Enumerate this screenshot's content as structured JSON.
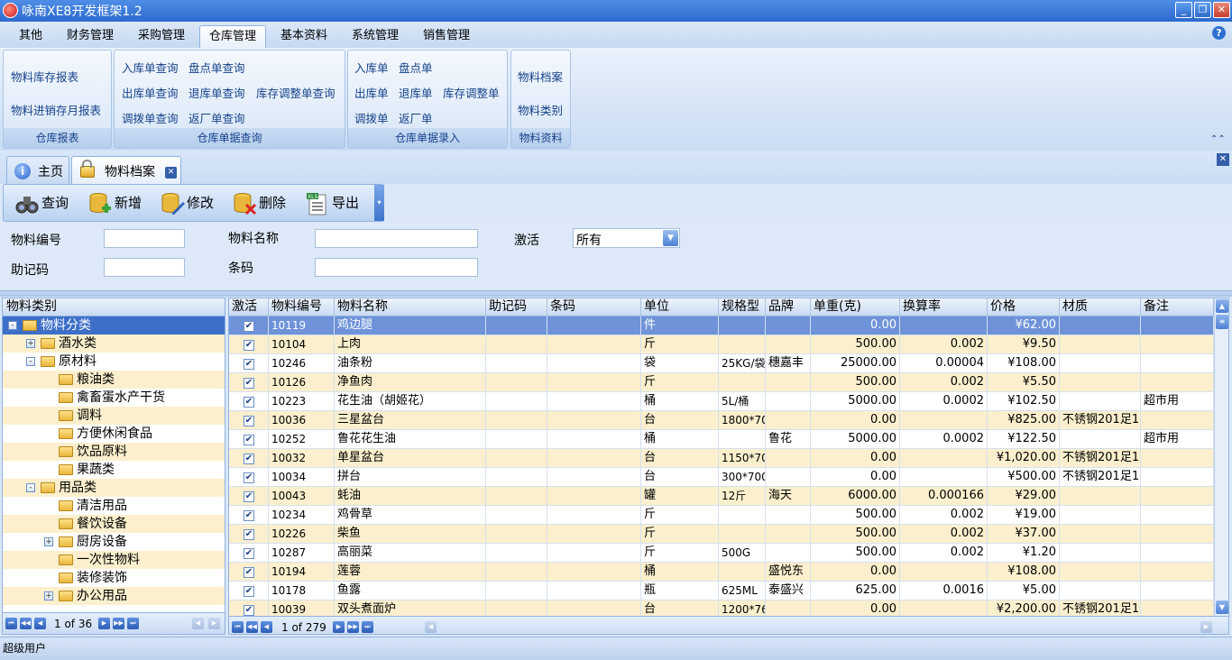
{
  "app": {
    "title": "咏南XE8开发框架1.2"
  },
  "menu": [
    "其他",
    "财务管理",
    "采购管理",
    "仓库管理",
    "基本资料",
    "系统管理",
    "销售管理"
  ],
  "ribbon": {
    "reports": {
      "caption": "仓库报表",
      "items": [
        "物料库存报表",
        "物料进销存月报表"
      ]
    },
    "query": {
      "caption": "仓库单据查询",
      "items": [
        "入库单查询",
        "盘点单查询",
        "出库单查询",
        "退库单查询",
        "库存调整单查询",
        "调拨单查询",
        "返厂单查询"
      ]
    },
    "entry": {
      "caption": "仓库单据录入",
      "items": [
        "入库单",
        "盘点单",
        "出库单",
        "退库单",
        "库存调整单",
        "调拨单",
        "返厂单"
      ]
    },
    "material": {
      "caption": "物料资料",
      "items": [
        "物料档案",
        "物料类别"
      ]
    }
  },
  "tabs": [
    "主页",
    "物料档案"
  ],
  "toolbar": [
    "查询",
    "新增",
    "修改",
    "删除",
    "导出"
  ],
  "filter": {
    "code_label": "物料编号",
    "name_label": "物料名称",
    "active_label": "激活",
    "active_value": "所有",
    "mnemonic_label": "助记码",
    "barcode_label": "条码"
  },
  "tree": {
    "header": "物料类别",
    "nodes": [
      "物料分类",
      "酒水类",
      "原材料",
      "粮油类",
      "禽畜蛋水产干货",
      "调料",
      "方便休闲食品",
      "饮品原料",
      "果蔬类",
      "用品类",
      "清洁用品",
      "餐饮设备",
      "厨房设备",
      "一次性物料",
      "装修装饰",
      "办公用品"
    ],
    "pager": "1 of 36"
  },
  "grid": {
    "columns": [
      "激活",
      "物料编号",
      "物料名称",
      "助记码",
      "条码",
      "单位",
      "规格型",
      "品牌",
      "单重(克)",
      "换算率",
      "价格",
      "材质",
      "备注"
    ],
    "rows": [
      [
        "✔",
        "10119",
        "鸡边腿",
        "",
        "",
        "件",
        "",
        "",
        "0.00",
        "",
        "¥62.00",
        "",
        ""
      ],
      [
        "✔",
        "10104",
        "上肉",
        "",
        "",
        "斤",
        "",
        "",
        "500.00",
        "0.002",
        "¥9.50",
        "",
        ""
      ],
      [
        "✔",
        "10246",
        "油条粉",
        "",
        "",
        "袋",
        "25KG/袋",
        "穗嘉丰",
        "25000.00",
        "0.00004",
        "¥108.00",
        "",
        ""
      ],
      [
        "✔",
        "10126",
        "净鱼肉",
        "",
        "",
        "斤",
        "",
        "",
        "500.00",
        "0.002",
        "¥5.50",
        "",
        ""
      ],
      [
        "✔",
        "10223",
        "花生油（胡姬花）",
        "",
        "",
        "桶",
        "5L/桶",
        "",
        "5000.00",
        "0.0002",
        "¥102.50",
        "",
        "超市用"
      ],
      [
        "✔",
        "10036",
        "三星盆台",
        "",
        "",
        "台",
        "1800*70",
        "",
        "0.00",
        "",
        "¥825.00",
        "不锈钢201足1",
        ""
      ],
      [
        "✔",
        "10252",
        "鲁花花生油",
        "",
        "",
        "桶",
        "",
        "鲁花",
        "5000.00",
        "0.0002",
        "¥122.50",
        "",
        "超市用"
      ],
      [
        "✔",
        "10032",
        "单星盆台",
        "",
        "",
        "台",
        "1150*70",
        "",
        "0.00",
        "",
        "¥1,020.00",
        "不锈钢201足1",
        ""
      ],
      [
        "✔",
        "10034",
        "拼台",
        "",
        "",
        "台",
        "300*700",
        "",
        "0.00",
        "",
        "¥500.00",
        "不锈钢201足1",
        ""
      ],
      [
        "✔",
        "10043",
        "蚝油",
        "",
        "",
        "罐",
        "12斤",
        "海天",
        "6000.00",
        "0.000166",
        "¥29.00",
        "",
        ""
      ],
      [
        "✔",
        "10234",
        "鸡骨草",
        "",
        "",
        "斤",
        "",
        "",
        "500.00",
        "0.002",
        "¥19.00",
        "",
        ""
      ],
      [
        "✔",
        "10226",
        "柴鱼",
        "",
        "",
        "斤",
        "",
        "",
        "500.00",
        "0.002",
        "¥37.00",
        "",
        ""
      ],
      [
        "✔",
        "10287",
        "高丽菜",
        "",
        "",
        "斤",
        "500G",
        "",
        "500.00",
        "0.002",
        "¥1.20",
        "",
        ""
      ],
      [
        "✔",
        "10194",
        "莲蓉",
        "",
        "",
        "桶",
        "",
        "盛悦东",
        "0.00",
        "",
        "¥108.00",
        "",
        ""
      ],
      [
        "✔",
        "10178",
        "鱼露",
        "",
        "",
        "瓶",
        "625ML",
        "泰盛兴",
        "625.00",
        "0.0016",
        "¥5.00",
        "",
        ""
      ],
      [
        "✔",
        "10039",
        "双头煮面炉",
        "",
        "",
        "台",
        "1200*76",
        "",
        "0.00",
        "",
        "¥2,200.00",
        "不锈钢201足1",
        ""
      ]
    ],
    "pager": "1 of 279"
  },
  "status": "超级用户"
}
